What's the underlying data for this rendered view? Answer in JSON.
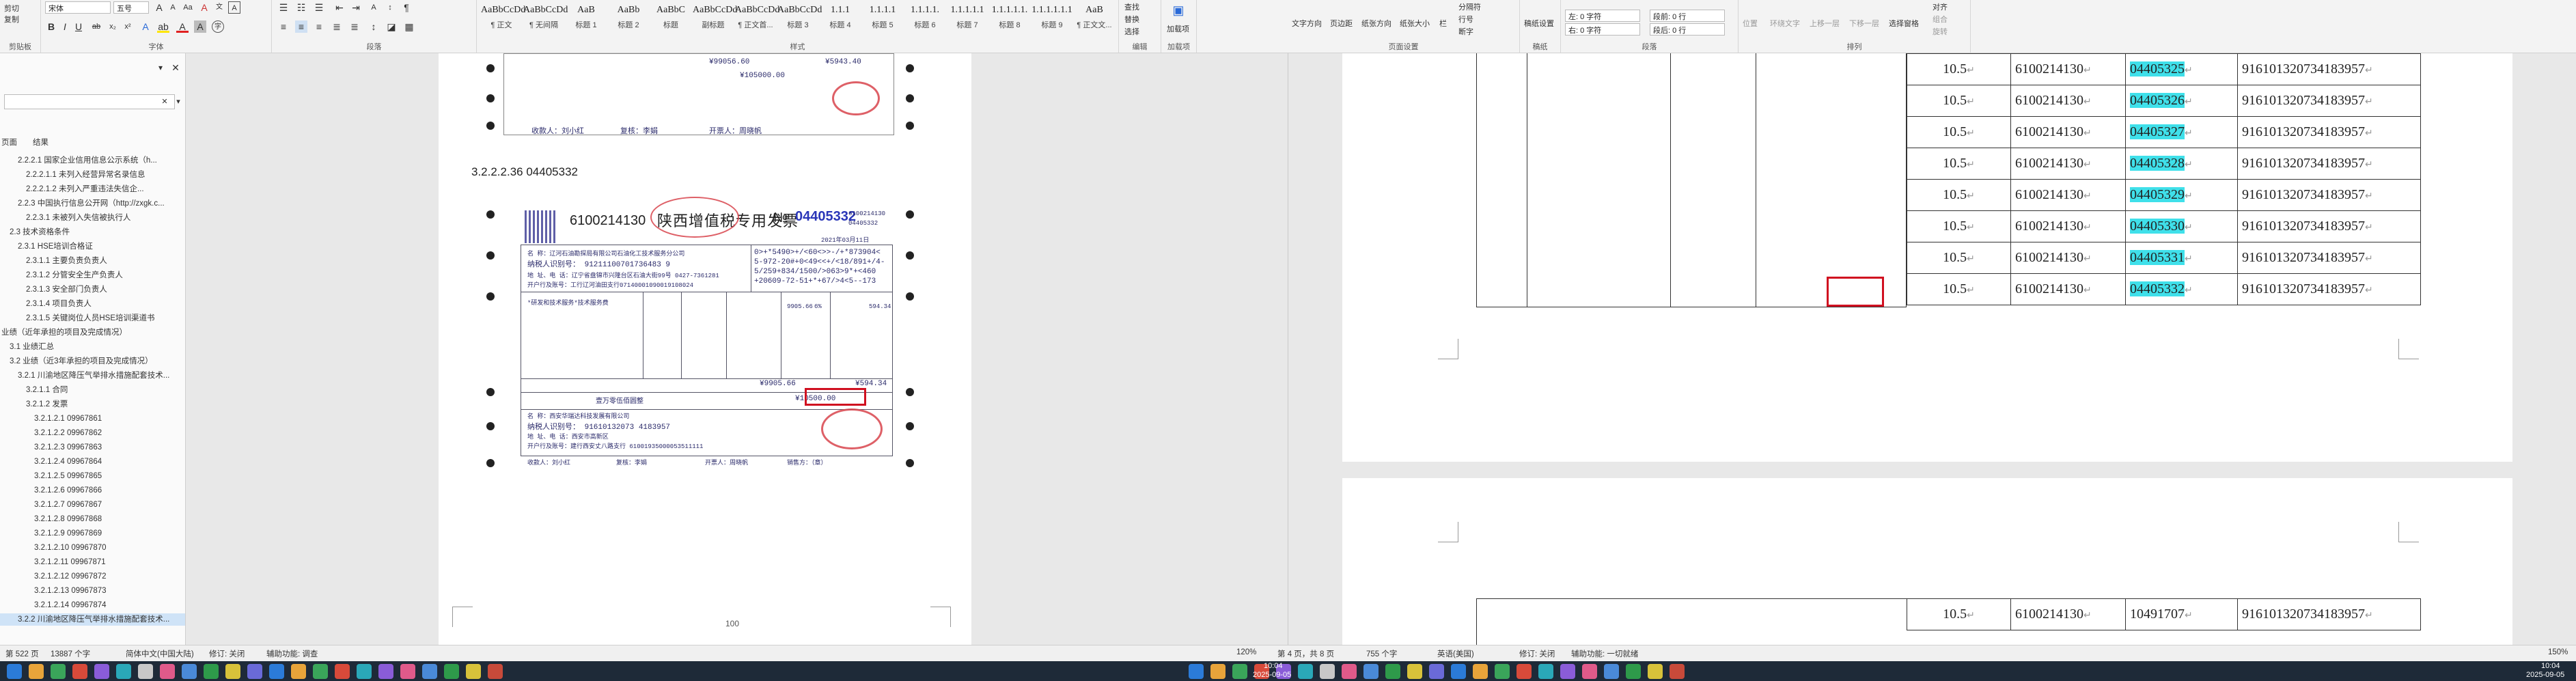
{
  "ribbon_left": {
    "clipboard": {
      "cut": "剪切",
      "copy": "复制",
      "label": "剪贴板"
    },
    "font": {
      "name": "宋体",
      "size": "五号",
      "label": "字体"
    },
    "paragraph": {
      "label": "段落"
    },
    "styles": {
      "label": "样式",
      "items": [
        {
          "preview": "AaBbCcDd",
          "name": "¶ 正文"
        },
        {
          "preview": "AaBbCcDd",
          "name": "¶ 无间隔"
        },
        {
          "preview": "AaB",
          "name": "标题 1"
        },
        {
          "preview": "AaBb",
          "name": "标题 2"
        },
        {
          "preview": "AaBbC",
          "name": "标题"
        },
        {
          "preview": "AaBbCcDd",
          "name": "副标题"
        },
        {
          "preview": "AaBbCcDd",
          "name": "¶ 正文首..."
        },
        {
          "preview": "AaBbCcDd",
          "name": "标题 3"
        },
        {
          "preview": "1.1.1",
          "name": "标题 4"
        },
        {
          "preview": "1.1.1.1",
          "name": "标题 5"
        },
        {
          "preview": "1.1.1.1.",
          "name": "标题 6"
        },
        {
          "preview": "1.1.1.1.1",
          "name": "标题 7"
        },
        {
          "preview": "1.1.1.1.1.",
          "name": "标题 8"
        },
        {
          "preview": "1.1.1.1.1.1",
          "name": "标题 9"
        },
        {
          "preview": "AaB",
          "name": "¶ 正文文..."
        }
      ]
    },
    "editing": {
      "find": "查找",
      "replace": "替换",
      "select": "选择",
      "label": "编辑"
    },
    "addin": {
      "label": "加载项",
      "name": "加载项"
    }
  },
  "ribbon_right": {
    "page_setup": {
      "text_dir": "文字方向",
      "margins": "页边距",
      "orientation": "纸张方向",
      "size": "纸张大小",
      "columns": "栏",
      "breaks": "分隔符",
      "line_numbers": "行号",
      "hyphen": "断字",
      "label": "页面设置"
    },
    "manuscript": {
      "label": "稿纸",
      "btn": "稿纸设置"
    },
    "paragraph": {
      "indent_left": "左: 0 字符",
      "indent_right": "右: 0 字符",
      "spacing_before": "段前: 0 行",
      "spacing_after": "段后: 0 行",
      "label": "段落"
    },
    "arrange": {
      "position": "位置",
      "wrap": "环绕文字",
      "forward": "上移一层",
      "backward": "下移一层",
      "selection": "选择窗格",
      "align": "对齐",
      "group": "组合",
      "rotate": "旋转",
      "label": "排列"
    }
  },
  "nav": {
    "search_placeholder": "",
    "tabs": [
      "页面",
      "结果"
    ],
    "items": [
      {
        "text": "2.2.2.1 国家企业信用信息公示系统（h...",
        "indent": 1
      },
      {
        "text": "2.2.2.1.1 未列入经营异常名录信息",
        "indent": 2
      },
      {
        "text": "2.2.2.1.2 未列入严重违法失信企...",
        "indent": 2
      },
      {
        "text": "2.2.3 中国执行信息公开网（http://zxgk.c...",
        "indent": 1
      },
      {
        "text": "2.2.3.1 未被列入失信被执行人",
        "indent": 2
      },
      {
        "text": "2.3 技术资格条件",
        "indent": 0
      },
      {
        "text": "2.3.1 HSE培训合格证",
        "indent": 1
      },
      {
        "text": "2.3.1.1 主要负责负责人",
        "indent": 2
      },
      {
        "text": "2.3.1.2 分管安全生产负责人",
        "indent": 2
      },
      {
        "text": "2.3.1.3 安全部门负责人",
        "indent": 2
      },
      {
        "text": "2.3.1.4 项目负责人",
        "indent": 2
      },
      {
        "text": "2.3.1.5 关键岗位人员HSE培训渠道书",
        "indent": 2
      },
      {
        "text": "业绩（近年承担的项目及完成情况）",
        "indent": -1
      },
      {
        "text": "3.1 业绩汇总",
        "indent": 0
      },
      {
        "text": "3.2 业绩（近3年承担的项目及完成情况）",
        "indent": 0
      },
      {
        "text": "3.2.1 川渝地区降压气举排水措施配套技术...",
        "indent": 1
      },
      {
        "text": "3.2.1.1 合同",
        "indent": 2
      },
      {
        "text": "3.2.1.2 发票",
        "indent": 2
      },
      {
        "text": "3.2.1.2.1 09967861",
        "indent": 3
      },
      {
        "text": "3.2.1.2.2 09967862",
        "indent": 3
      },
      {
        "text": "3.2.1.2.3 09967863",
        "indent": 3
      },
      {
        "text": "3.2.1.2.4 09967864",
        "indent": 3
      },
      {
        "text": "3.2.1.2.5 09967865",
        "indent": 3
      },
      {
        "text": "3.2.1.2.6 09967866",
        "indent": 3
      },
      {
        "text": "3.2.1.2.7 09967867",
        "indent": 3
      },
      {
        "text": "3.2.1.2.8 09967868",
        "indent": 3
      },
      {
        "text": "3.2.1.2.9 09967869",
        "indent": 3
      },
      {
        "text": "3.2.1.2.10 09967870",
        "indent": 3
      },
      {
        "text": "3.2.1.2.11 09967871",
        "indent": 3
      },
      {
        "text": "3.2.1.2.12 09967872",
        "indent": 3
      },
      {
        "text": "3.2.1.2.13 09967873",
        "indent": 3
      },
      {
        "text": "3.2.1.2.14 09967874",
        "indent": 3
      },
      {
        "text": "3.2.2 川渝地区降压气举排水措施配套技术...",
        "indent": 1,
        "selected": true
      }
    ]
  },
  "doc_left": {
    "heading": "3.2.2.2.36 04405332",
    "page_number": "100",
    "invoice_top": {
      "amount_big": "¥99056.60",
      "amount_tax": "¥5943.40",
      "total": "¥105000.00",
      "payee": "收款人：刘小红",
      "reviewer": "复核：李娟",
      "drawer": "开票人：周晓帆"
    },
    "invoice": {
      "title": "陕西增值税专用发票",
      "code": "6100214130",
      "no_label": "№",
      "number": "04405332",
      "code_small": "6100214130",
      "number_small": "04405332",
      "date": "2021年03月11日",
      "buyer_name": "名    称：辽河石油勘探局有限公司石油化工技术服务分公司",
      "buyer_tax": "纳税人识别号：  91211100701736483 9",
      "buyer_addr": "地 址、电 话：辽宁省盘锦市兴隆台区石油大街99号 0427-7361281",
      "buyer_bank": "开户行及账号：工行辽河油田支行07140001090019108024",
      "cipher": [
        "0>+*5490>+/<60<>>-/+*873904<",
        "5-972-20#+0<49<<+/<18/891+/4-",
        "5/259+834/1500/>063>9*+<460",
        "+20609-72-51+*+67/>4<5--173"
      ],
      "item_name": "*研发和技术服务*技术服务费",
      "amount": "9905.66",
      "rate": "6%",
      "tax": "594.34",
      "subtotal": "¥9905.66",
      "subtax": "¥594.34",
      "total_cn": "壹万零伍佰圆整",
      "total_small": "¥10500.00",
      "seller_name": "名    称：西安华瑞达科技发展有限公司",
      "seller_tax": "纳税人识别号：  91610132073 4183957",
      "seller_addr": "地 址、电 话：西安市高新区",
      "seller_bank": "开户行及账号：建行西安丈八路支行 61001935000053511111",
      "payee": "收款人：刘小红",
      "reviewer": "复核：李娟",
      "drawer": "开票人：周晓帆",
      "seller_label": "销售方：（章）"
    }
  },
  "table_right": {
    "rows": [
      {
        "rate": "10.5",
        "code": "6100214130",
        "no": "04405325",
        "tax": "916101320734183957"
      },
      {
        "rate": "10.5",
        "code": "6100214130",
        "no": "04405326",
        "tax": "916101320734183957"
      },
      {
        "rate": "10.5",
        "code": "6100214130",
        "no": "04405327",
        "tax": "916101320734183957"
      },
      {
        "rate": "10.5",
        "code": "6100214130",
        "no": "04405328",
        "tax": "916101320734183957"
      },
      {
        "rate": "10.5",
        "code": "6100214130",
        "no": "04405329",
        "tax": "916101320734183957"
      },
      {
        "rate": "10.5",
        "code": "6100214130",
        "no": "04405330",
        "tax": "916101320734183957"
      },
      {
        "rate": "10.5",
        "code": "6100214130",
        "no": "04405331",
        "tax": "916101320734183957"
      },
      {
        "rate": "10.5",
        "code": "6100214130",
        "no": "04405332",
        "tax": "916101320734183957"
      }
    ],
    "rows_page2": [
      {
        "rate": "10.5",
        "code": "6100214130",
        "no": "10491707",
        "tax": "916101320734183957"
      }
    ]
  },
  "status_left": {
    "page": "第 522 页",
    "words": "13887 个字",
    "lang": "简体中文(中国大陆)",
    "track": "修订: 关闭",
    "access": "辅助功能: 调查"
  },
  "status_right": {
    "page": "第 4 页，共 8 页",
    "words": "755 个字",
    "lang": "英语(美国)",
    "track": "修订: 关闭",
    "access": "辅助功能: 一切就绪",
    "zoom_left": "120%",
    "zoom_right": "150%"
  },
  "taskbar": {
    "time_left": "10:04",
    "date_left": "2025-09-05",
    "time_right": "10:04",
    "date_right": "2025-09-05"
  },
  "colors": {
    "highlight": "#3fe0ea",
    "redbox": "#d01020",
    "nav_selected": "#cfe3f7"
  }
}
